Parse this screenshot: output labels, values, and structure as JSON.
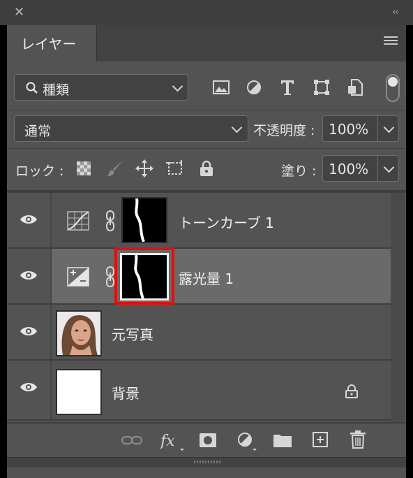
{
  "panel": {
    "title": "レイヤー"
  },
  "filter": {
    "label": "種類"
  },
  "blend": {
    "mode": "通常",
    "opacity_label": "不透明度 :",
    "opacity_value": "100%"
  },
  "lock": {
    "label": "ロック :",
    "fill_label": "塗り :",
    "fill_value": "100%"
  },
  "layers": [
    {
      "name": "トーンカーブ 1",
      "type": "curves-adjustment",
      "selected": false
    },
    {
      "name": "露光量 1",
      "type": "exposure-adjustment",
      "selected": true
    },
    {
      "name": "元写真",
      "type": "photo",
      "selected": false
    },
    {
      "name": "背景",
      "type": "background",
      "selected": false,
      "locked": true
    }
  ],
  "colors": {
    "panel_bg": "#535353",
    "selected_bg": "#6a6a6a",
    "highlight": "#e01010"
  }
}
